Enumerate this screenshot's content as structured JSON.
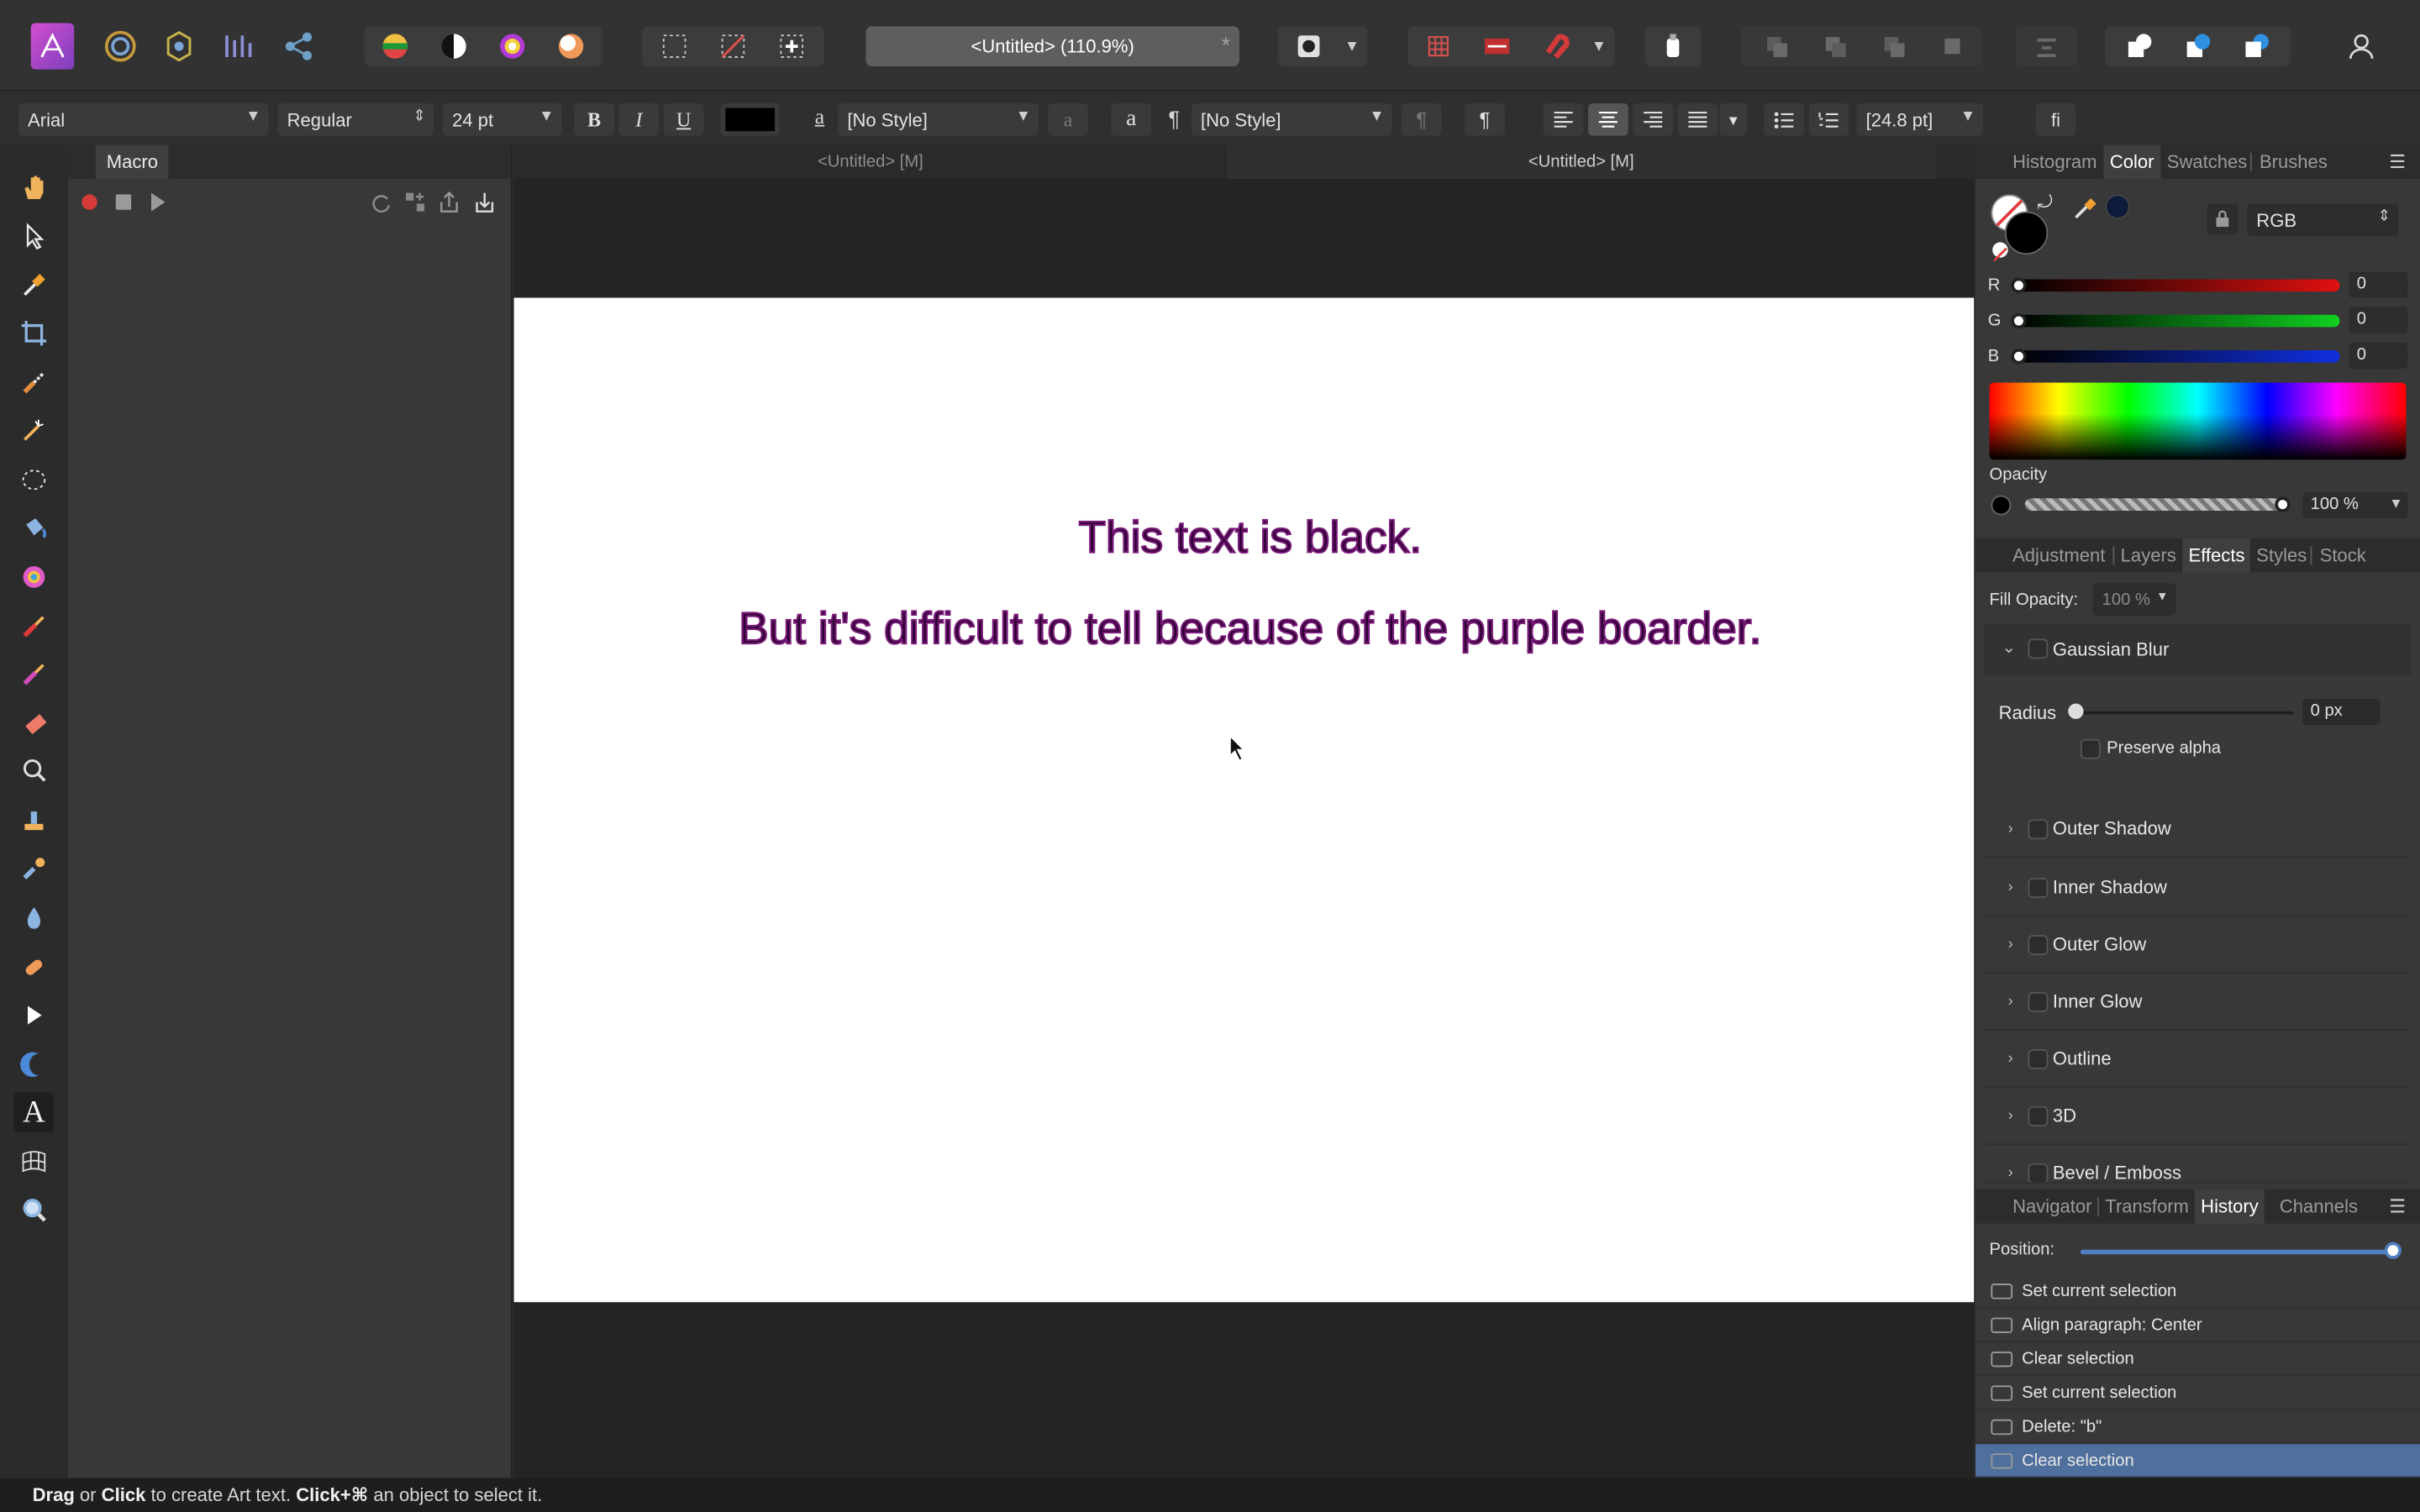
{
  "app": {
    "doc_title": "<Untitled> (110.9%)",
    "doc_star": "*"
  },
  "context": {
    "font": "Arial",
    "weight": "Regular",
    "size": "24 pt",
    "bold": "B",
    "italic": "I",
    "underline": "U",
    "char_style_glyph": "a",
    "char_style": "[No Style]",
    "para_glyph": "¶",
    "para_style": "[No Style]",
    "leading": "[24.8 pt]",
    "ligature": "fi",
    "text_color": "#000000"
  },
  "macro": {
    "tab": "Macro"
  },
  "doc_tabs": [
    {
      "label": "<Untitled> [M]"
    },
    {
      "label": "<Untitled> [M]"
    }
  ],
  "canvas": {
    "line1": "This text is black.",
    "line2": "But it's difficult to tell because of the purple boarder."
  },
  "color_panel": {
    "tabs": [
      "Histogram",
      "Color",
      "Swatches",
      "Brushes"
    ],
    "active_tab": "Color",
    "mode": "RGB",
    "r_label": "R",
    "r_value": "0",
    "g_label": "G",
    "g_value": "0",
    "b_label": "B",
    "b_value": "0",
    "opacity_label": "Opacity",
    "opacity_value": "100 %"
  },
  "effects_panel": {
    "tabs": [
      "Adjustment",
      "Layers",
      "Effects",
      "Styles",
      "Stock"
    ],
    "active_tab": "Effects",
    "fill_opacity_label": "Fill Opacity:",
    "fill_opacity_value": "100 %",
    "gaussian": "Gaussian Blur",
    "radius_label": "Radius",
    "radius_value": "0 px",
    "preserve_alpha": "Preserve alpha",
    "effects": [
      "Outer Shadow",
      "Inner Shadow",
      "Outer Glow",
      "Inner Glow",
      "Outline",
      "3D",
      "Bevel / Emboss"
    ]
  },
  "history_panel": {
    "tabs": [
      "Navigator",
      "Transform",
      "History",
      "Channels"
    ],
    "active_tab": "History",
    "position_label": "Position:",
    "items": [
      "Set current selection",
      "Align paragraph: Center",
      "Clear selection",
      "Set current selection",
      "Delete: \"b\"",
      "Clear selection"
    ]
  },
  "status": {
    "w1": "Drag",
    "w2": " or ",
    "w3": "Click",
    "w4": " to create Art text. ",
    "w5": "Click+⌘",
    "w6": " an object to select it."
  }
}
